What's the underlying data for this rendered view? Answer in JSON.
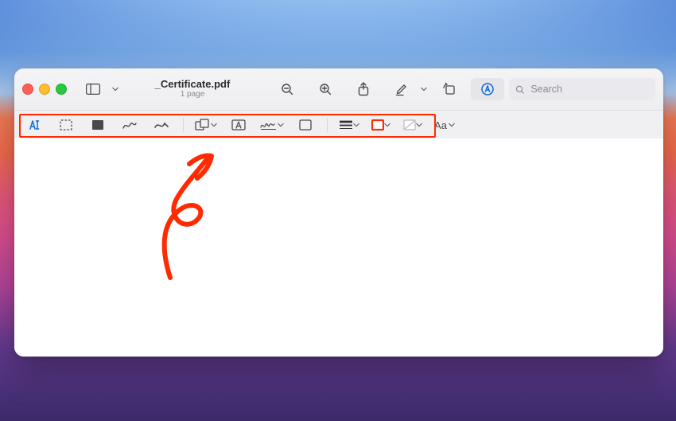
{
  "window": {
    "title": "_Certificate.pdf",
    "subtitle": "1 page"
  },
  "search": {
    "placeholder": "Search",
    "value": ""
  },
  "text_style": {
    "label": "Aa"
  },
  "icons": {
    "sidebar": "sidebar-icon",
    "zoom_out": "zoom-out-icon",
    "zoom_in": "zoom-in-icon",
    "share": "share-icon",
    "highlight": "highlight-pen-icon",
    "rotate": "rotate-icon",
    "markup": "markup-icon",
    "search": "search-icon",
    "text_tool": "text-tool-icon",
    "select_rect": "rect-select-icon",
    "redact": "redact-icon",
    "sketch": "sketch-icon",
    "draw": "draw-icon",
    "shapes": "shapes-icon",
    "textbox": "textbox-icon",
    "sign": "sign-icon",
    "note": "note-icon",
    "stroke_style": "stroke-style-icon",
    "border_color": "border-color-icon",
    "fill_color": "fill-color-icon"
  },
  "colors": {
    "accent": "#1169d9",
    "annotation_red": "#ff2a00",
    "border_swatch": "#ff2a00"
  }
}
